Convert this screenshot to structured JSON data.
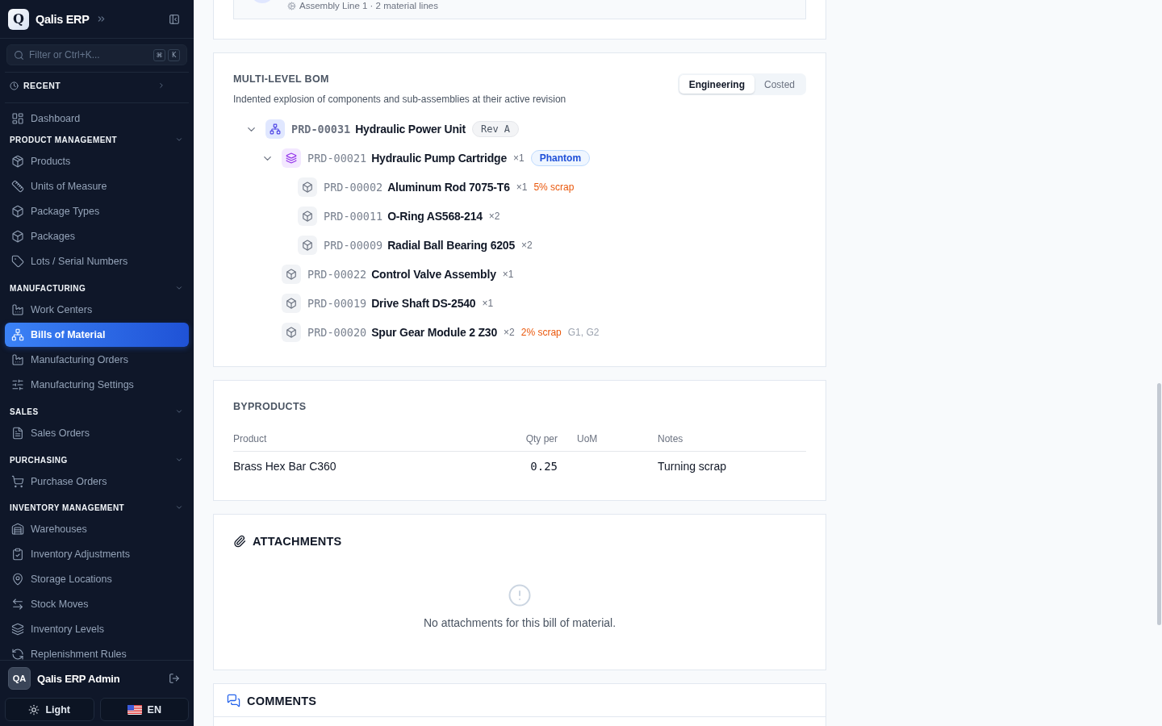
{
  "sidebar": {
    "brand": {
      "logo_letter": "Q",
      "name": "Qalis ERP"
    },
    "search": {
      "placeholder": "Filter or Ctrl+K...",
      "keys": [
        "⌘",
        "K"
      ]
    },
    "recent": {
      "label": "RECENT",
      "expanded": false
    },
    "nav": [
      {
        "items": [
          {
            "label": "Dashboard",
            "selected": false
          }
        ]
      },
      {
        "title": "PRODUCT MANAGEMENT",
        "expanded": true,
        "items": [
          {
            "label": "Products",
            "selected": false
          },
          {
            "label": "Units of Measure",
            "selected": false
          },
          {
            "label": "Package Types",
            "selected": false
          },
          {
            "label": "Packages",
            "selected": false
          },
          {
            "label": "Lots / Serial Numbers",
            "selected": false
          }
        ]
      },
      {
        "title": "MANUFACTURING",
        "expanded": true,
        "items": [
          {
            "label": "Work Centers",
            "selected": false
          },
          {
            "label": "Bills of Material",
            "selected": true
          },
          {
            "label": "Manufacturing Orders",
            "selected": false
          },
          {
            "label": "Manufacturing Settings",
            "selected": false
          }
        ]
      },
      {
        "title": "SALES",
        "expanded": true,
        "items": [
          {
            "label": "Sales Orders",
            "selected": false
          }
        ]
      },
      {
        "title": "PURCHASING",
        "expanded": true,
        "items": [
          {
            "label": "Purchase Orders",
            "selected": false
          }
        ]
      },
      {
        "title": "INVENTORY MANAGEMENT",
        "expanded": true,
        "items": [
          {
            "label": "Warehouses",
            "selected": false
          },
          {
            "label": "Inventory Adjustments",
            "selected": false
          },
          {
            "label": "Storage Locations",
            "selected": false
          },
          {
            "label": "Stock Moves",
            "selected": false
          },
          {
            "label": "Inventory Levels",
            "selected": false
          },
          {
            "label": "Replenishment Rules",
            "selected": false
          }
        ]
      }
    ],
    "user": {
      "initials": "QA",
      "name": "Qalis ERP Admin"
    },
    "theme_button": {
      "label": "Light"
    },
    "language_button": {
      "label": "EN"
    }
  },
  "previous_card": {
    "meta": "Assembly Line 1 · 2 material lines"
  },
  "bom": {
    "title": "MULTI-LEVEL BOM",
    "description": "Indented explosion of components and sub-assemblies at their active revision",
    "views": [
      {
        "label": "Engineering",
        "selected": true
      },
      {
        "label": "Costed",
        "selected": false
      }
    ],
    "tree": [
      {
        "kind": "assembly",
        "code": "PRD-00031",
        "name": "Hydraulic Power Unit",
        "badge": {
          "kind": "revision",
          "label": "Rev A"
        },
        "expanded": true,
        "children": [
          {
            "kind": "phantom",
            "code": "PRD-00021",
            "name": "Hydraulic Pump Cartridge",
            "qty": "×1",
            "badge": {
              "kind": "phantom",
              "label": "Phantom"
            },
            "expanded": true,
            "children": [
              {
                "kind": "component",
                "code": "PRD-00002",
                "name": "Aluminum Rod 7075-T6",
                "qty": "×1",
                "scrap": "5% scrap"
              },
              {
                "kind": "component",
                "code": "PRD-00011",
                "name": "O-Ring AS568-214",
                "qty": "×2"
              },
              {
                "kind": "component",
                "code": "PRD-00009",
                "name": "Radial Ball Bearing 6205",
                "qty": "×2"
              }
            ]
          },
          {
            "kind": "component",
            "code": "PRD-00022",
            "name": "Control Valve Assembly",
            "qty": "×1"
          },
          {
            "kind": "component",
            "code": "PRD-00019",
            "name": "Drive Shaft DS-2540",
            "qty": "×1"
          },
          {
            "kind": "component",
            "code": "PRD-00020",
            "name": "Spur Gear Module 2 Z30",
            "qty": "×2",
            "scrap": "2% scrap",
            "refs": "G1, G2"
          }
        ]
      }
    ]
  },
  "byproducts": {
    "title": "BYPRODUCTS",
    "columns": [
      "Product",
      "Qty per",
      "UoM",
      "Notes"
    ],
    "rows": [
      {
        "product": "Brass Hex Bar C360",
        "qty_per": "0.25",
        "notes": "Turning scrap"
      }
    ]
  },
  "attachments": {
    "title": "ATTACHMENTS",
    "empty_message": "No attachments for this bill of material."
  },
  "comments": {
    "title": "COMMENTS"
  }
}
